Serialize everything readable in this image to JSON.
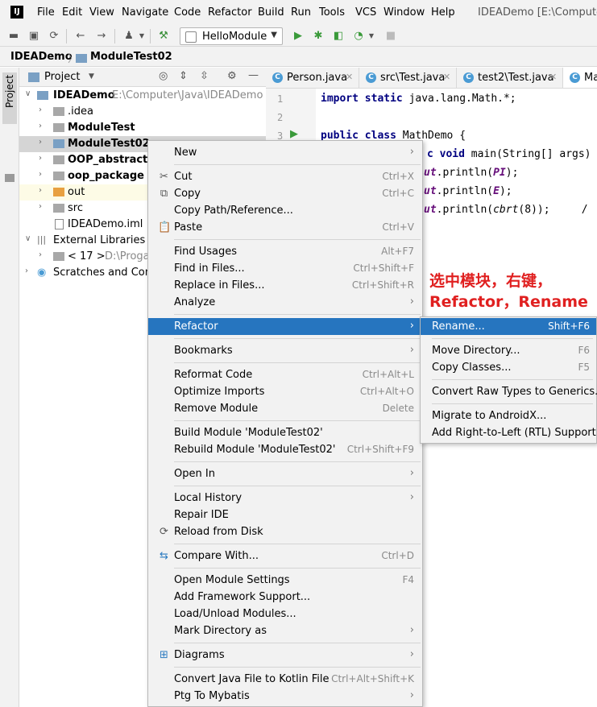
{
  "app": {
    "logo": "IJ",
    "window_title": "IDEADemo [E:\\Computer\\"
  },
  "menubar": [
    "File",
    "Edit",
    "View",
    "Navigate",
    "Code",
    "Refactor",
    "Build",
    "Run",
    "Tools",
    "VCS",
    "Window",
    "Help"
  ],
  "toolbar": {
    "run_config": "HelloModule"
  },
  "breadcrumb": [
    "IDEADemo",
    "ModuleTest02"
  ],
  "side_strip": {
    "label": "Project"
  },
  "project_panel": {
    "title": "Project"
  },
  "tree": [
    {
      "label": "IDEADemo",
      "extra": "E:\\Computer\\Java\\IDEADemo"
    },
    {
      "label": ".idea"
    },
    {
      "label": "ModuleTest"
    },
    {
      "label": "ModuleTest02"
    },
    {
      "label": "OOP_abstract"
    },
    {
      "label": "oop_package"
    },
    {
      "label": "out"
    },
    {
      "label": "src"
    },
    {
      "label": "IDEADemo.iml"
    },
    {
      "label": "External Libraries"
    },
    {
      "label": "< 17 >",
      "extra": "D:\\Proga"
    },
    {
      "label": "Scratches and Conso"
    }
  ],
  "tabs": [
    "Person.java",
    "src\\Test.java",
    "test2\\Test.java",
    "Ma"
  ],
  "code": {
    "line_numbers": [
      "1",
      "2",
      "3"
    ],
    "l1_kw": "import static",
    "l1_rest": " java.lang.Math.*;",
    "l3_kw": "public class",
    "l3_rest": " MathDemo {",
    "l4_a": "c ",
    "l4_kw": "void",
    "l4_rest": " main(String[] args)",
    "l5_a": "ut",
    "l5_b": ".println(",
    "l5_c": "PI",
    "l5_d": ");",
    "l6_a": "ut",
    "l6_b": ".println(",
    "l6_c": "E",
    "l6_d": ");",
    "l7_a": "ut",
    "l7_b": ".println(",
    "l7_c": "cbrt",
    "l7_d": "(8));     /"
  },
  "annotation": {
    "line1": "选中模块，右键，",
    "line2": "Refactor，Rename"
  },
  "context_menu": [
    {
      "label": "New",
      "arrow": "›"
    },
    {
      "label": "Cut",
      "shortcut": "Ctrl+X"
    },
    {
      "label": "Copy",
      "shortcut": "Ctrl+C"
    },
    {
      "label": "Copy Path/Reference..."
    },
    {
      "label": "Paste",
      "shortcut": "Ctrl+V"
    },
    {
      "label": "Find Usages",
      "shortcut": "Alt+F7"
    },
    {
      "label": "Find in Files...",
      "shortcut": "Ctrl+Shift+F"
    },
    {
      "label": "Replace in Files...",
      "shortcut": "Ctrl+Shift+R"
    },
    {
      "label": "Analyze",
      "arrow": "›"
    },
    {
      "label": "Refactor",
      "arrow": "›"
    },
    {
      "label": "Bookmarks",
      "arrow": "›"
    },
    {
      "label": "Reformat Code",
      "shortcut": "Ctrl+Alt+L"
    },
    {
      "label": "Optimize Imports",
      "shortcut": "Ctrl+Alt+O"
    },
    {
      "label": "Remove Module",
      "shortcut": "Delete"
    },
    {
      "label": "Build Module 'ModuleTest02'"
    },
    {
      "label": "Rebuild Module 'ModuleTest02'",
      "shortcut": "Ctrl+Shift+F9"
    },
    {
      "label": "Open In",
      "arrow": "›"
    },
    {
      "label": "Local History",
      "arrow": "›"
    },
    {
      "label": "Repair IDE"
    },
    {
      "label": "Reload from Disk"
    },
    {
      "label": "Compare With...",
      "shortcut": "Ctrl+D"
    },
    {
      "label": "Open Module Settings",
      "shortcut": "F4"
    },
    {
      "label": "Add Framework Support..."
    },
    {
      "label": "Load/Unload Modules..."
    },
    {
      "label": "Mark Directory as",
      "arrow": "›"
    },
    {
      "label": "Diagrams",
      "arrow": "›"
    },
    {
      "label": "Convert Java File to Kotlin File",
      "shortcut": "Ctrl+Alt+Shift+K"
    },
    {
      "label": "Ptg To Mybatis",
      "arrow": "›"
    }
  ],
  "refactor_submenu": [
    {
      "label": "Rename...",
      "shortcut": "Shift+F6"
    },
    {
      "label": "Move Directory...",
      "shortcut": "F6"
    },
    {
      "label": "Copy Classes...",
      "shortcut": "F5"
    },
    {
      "label": "Convert Raw Types to Generics..."
    },
    {
      "label": "Migrate to AndroidX..."
    },
    {
      "label": "Add Right-to-Left (RTL) Support..."
    }
  ],
  "colors": {
    "selection": "#2675bf",
    "annotation": "#e02020",
    "keyword": "#000080"
  }
}
